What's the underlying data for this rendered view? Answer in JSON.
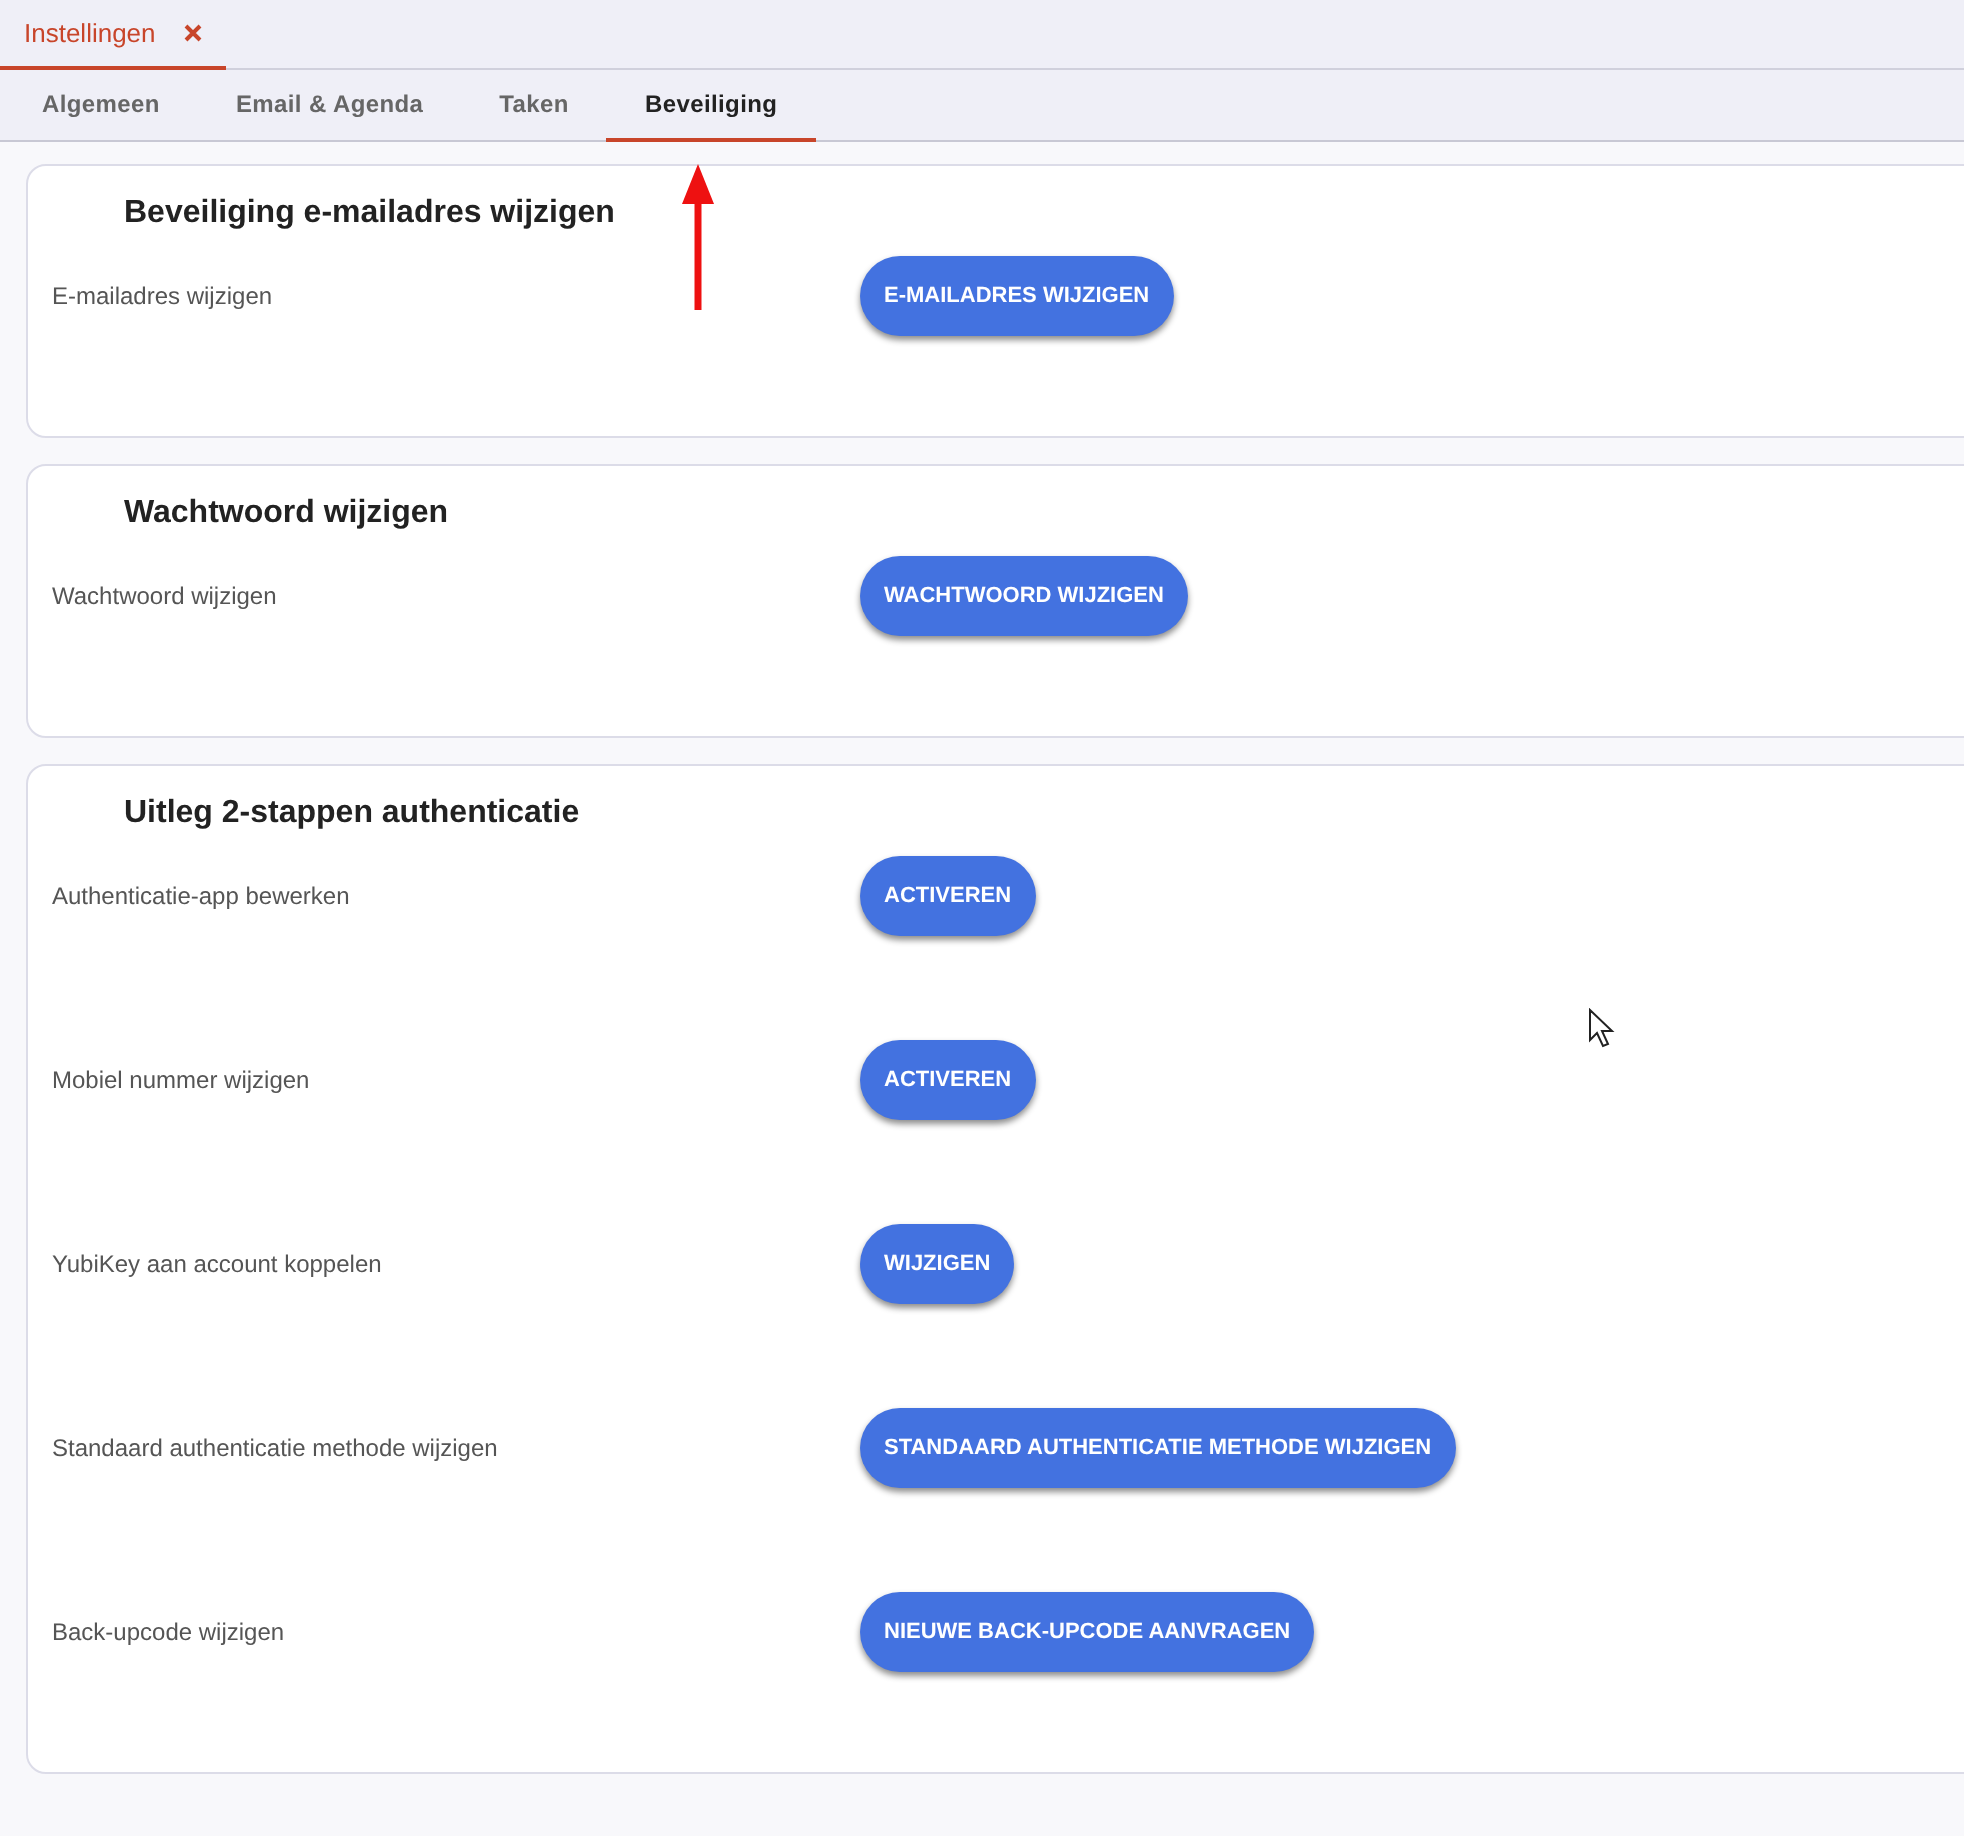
{
  "top_tabs": [
    {
      "label": "Instellingen",
      "selected": true,
      "closable": true
    }
  ],
  "tabs": [
    {
      "label": "Algemeen",
      "selected": false
    },
    {
      "label": "Email & Agenda",
      "selected": false
    },
    {
      "label": "Taken",
      "selected": false
    },
    {
      "label": "Beveiliging",
      "selected": true
    }
  ],
  "sections": [
    {
      "title": "Beveiliging e-mailadres wijzigen",
      "rows": [
        {
          "label": "E-mailadres wijzigen",
          "button": "E-MAILADRES WIJZIGEN"
        }
      ]
    },
    {
      "title": "Wachtwoord wijzigen",
      "rows": [
        {
          "label": "Wachtwoord wijzigen",
          "button": "WACHTWOORD WIJZIGEN"
        }
      ]
    },
    {
      "title": "Uitleg 2-stappen authenticatie",
      "rows": [
        {
          "label": "Authenticatie-app bewerken",
          "button": "ACTIVEREN"
        },
        {
          "label": "Mobiel nummer wijzigen",
          "button": "ACTIVEREN"
        },
        {
          "label": "YubiKey aan account koppelen",
          "button": "WIJZIGEN"
        },
        {
          "label": "Standaard authenticatie methode wijzigen",
          "button": "STANDAARD AUTHENTICATIE METHODE WIJZIGEN"
        },
        {
          "label": "Back-upcode wijzigen",
          "button": "NIEUWE BACK-UPCODE AANVRAGEN"
        }
      ]
    }
  ]
}
